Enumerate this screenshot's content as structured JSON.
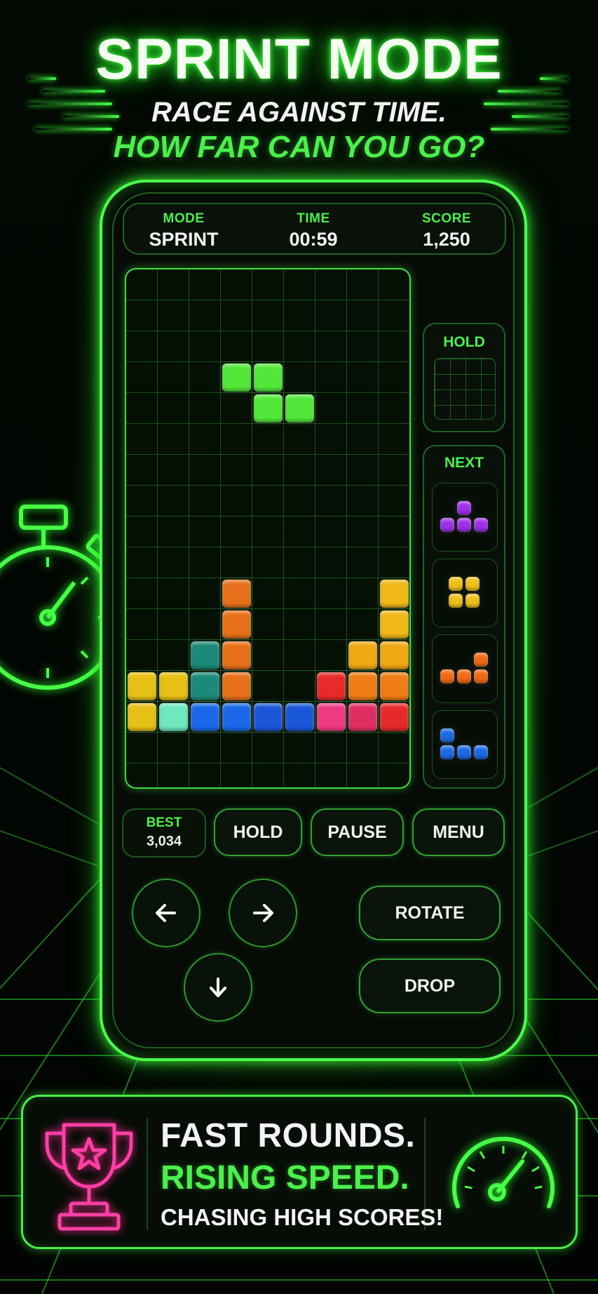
{
  "header_title": "SPRINT MODE",
  "subtitle_line1": "RACE AGAINST TIME.",
  "subtitle_line2": "HOW FAR CAN YOU GO?",
  "hud": {
    "mode_label": "MODE",
    "mode_value": "SPRINT",
    "time_label": "TIME",
    "time_value": "00:59",
    "score_label": "SCORE",
    "score_value": "1,250"
  },
  "side": {
    "hold_label": "HOLD",
    "next_label": "NEXT"
  },
  "best": {
    "label": "BEST",
    "value": "3,034"
  },
  "buttons": {
    "hold": "HOLD",
    "pause": "PAUSE",
    "menu": "MENU",
    "rotate": "ROTATE",
    "drop": "DROP"
  },
  "controls": {
    "left_icon": "arrow-left-icon",
    "right_icon": "arrow-right-icon",
    "down_icon": "arrow-down-icon"
  },
  "banner": {
    "line1": "FAST ROUNDS.",
    "line2": "RISING SPEED.",
    "line3": "CHASING HIGH SCORES!",
    "left_icon": "trophy-icon",
    "right_icon": "speedometer-icon"
  },
  "board": {
    "columns": 9,
    "rows": 17,
    "active_piece": {
      "color": "#52e83a",
      "cells": [
        [
          3,
          3
        ],
        [
          4,
          3
        ],
        [
          4,
          4
        ],
        [
          5,
          4
        ]
      ]
    },
    "locked_cells": [
      {
        "col": 0,
        "row": 13,
        "color": "#e6c014"
      },
      {
        "col": 1,
        "row": 13,
        "color": "#e6c014"
      },
      {
        "col": 0,
        "row": 14,
        "color": "#e6c014"
      },
      {
        "col": 1,
        "row": 14,
        "color": "#6fe8c0"
      },
      {
        "col": 2,
        "row": 14,
        "color": "#1a67e8"
      },
      {
        "col": 3,
        "row": 14,
        "color": "#1a67e8"
      },
      {
        "col": 4,
        "row": 14,
        "color": "#1a57d8"
      },
      {
        "col": 5,
        "row": 14,
        "color": "#1a57d8"
      },
      {
        "col": 6,
        "row": 14,
        "color": "#ee3a82"
      },
      {
        "col": 7,
        "row": 14,
        "color": "#e02e62"
      },
      {
        "col": 8,
        "row": 14,
        "color": "#e62a2a"
      },
      {
        "col": 2,
        "row": 12,
        "color": "#1c8a78"
      },
      {
        "col": 2,
        "row": 13,
        "color": "#1c8a78"
      },
      {
        "col": 3,
        "row": 10,
        "color": "#e7701a"
      },
      {
        "col": 3,
        "row": 11,
        "color": "#e7701a"
      },
      {
        "col": 3,
        "row": 12,
        "color": "#e7701a"
      },
      {
        "col": 3,
        "row": 13,
        "color": "#e7701a"
      },
      {
        "col": 6,
        "row": 13,
        "color": "#e82a2a"
      },
      {
        "col": 7,
        "row": 12,
        "color": "#f0a815"
      },
      {
        "col": 7,
        "row": 13,
        "color": "#f07d15"
      },
      {
        "col": 8,
        "row": 10,
        "color": "#f0b818"
      },
      {
        "col": 8,
        "row": 11,
        "color": "#f0b818"
      },
      {
        "col": 8,
        "row": 12,
        "color": "#f0a815"
      },
      {
        "col": 8,
        "row": 13,
        "color": "#f07d15"
      }
    ]
  },
  "next_queue": [
    {
      "color": "#9d2fe8",
      "cells": [
        [
          1,
          0
        ],
        [
          0,
          1
        ],
        [
          1,
          1
        ],
        [
          2,
          1
        ]
      ]
    },
    {
      "color": "#f0c018",
      "cells": [
        [
          0,
          0
        ],
        [
          1,
          0
        ],
        [
          0,
          1
        ],
        [
          1,
          1
        ]
      ]
    },
    {
      "color": "#f06a12",
      "cells": [
        [
          2,
          0
        ],
        [
          0,
          1
        ],
        [
          1,
          1
        ],
        [
          2,
          1
        ]
      ]
    },
    {
      "color": "#1a6ae8",
      "cells": [
        [
          0,
          0
        ],
        [
          0,
          1
        ],
        [
          1,
          1
        ],
        [
          2,
          1
        ]
      ]
    }
  ]
}
